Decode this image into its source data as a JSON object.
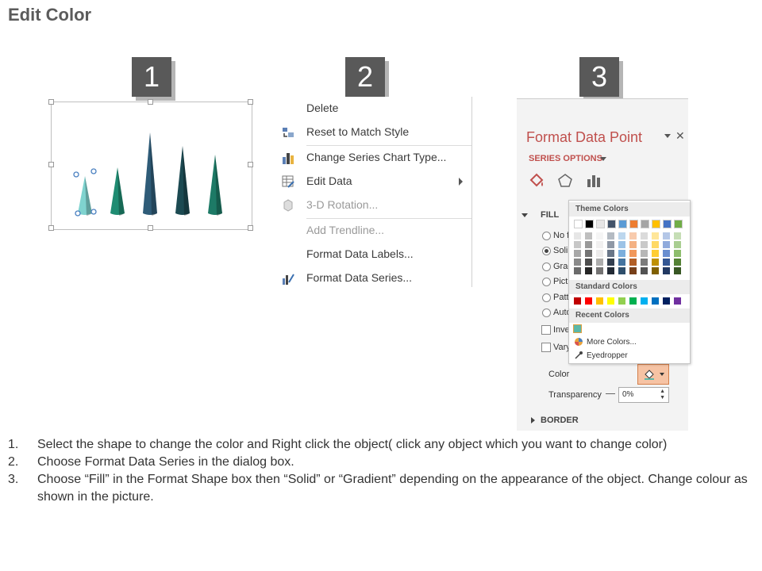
{
  "page": {
    "title": "Edit Color"
  },
  "badges": [
    "1",
    "2",
    "3"
  ],
  "context_menu": {
    "items": [
      {
        "label": "Delete",
        "icon": "none",
        "enabled": true
      },
      {
        "label": "Reset to Match Style",
        "icon": "reset-style-icon",
        "enabled": true
      },
      {
        "label": "Change Series Chart Type...",
        "icon": "bar-chart-icon",
        "enabled": true
      },
      {
        "label": "Edit Data",
        "icon": "edit-data-icon",
        "enabled": true,
        "submenu": true
      },
      {
        "label": "3-D Rotation...",
        "icon": "cube-icon",
        "enabled": false
      },
      {
        "label": "Add Trendline...",
        "icon": "none",
        "enabled": false
      },
      {
        "label": "Format Data Labels...",
        "icon": "none",
        "enabled": true
      },
      {
        "label": "Format Data Series...",
        "icon": "format-series-icon",
        "enabled": true
      }
    ]
  },
  "format_pane": {
    "title": "Format Data Point",
    "series_options": "SERIES OPTIONS",
    "fill_section": "FILL",
    "fill_options": [
      "No f",
      "Soli",
      "Grad",
      "Pict",
      "Patt",
      "Auto"
    ],
    "selected_option": 1,
    "checkboxes": [
      "Inve",
      "Vary"
    ],
    "color_label": "Color",
    "transparency_label": "Transparency",
    "transparency_value": "0%",
    "border_section": "BORDER"
  },
  "color_popup": {
    "theme_label": "Theme Colors",
    "standard_label": "Standard Colors",
    "recent_label": "Recent Colors",
    "more_colors": "More Colors...",
    "eyedropper": "Eyedropper",
    "theme_top_row": [
      "#ffffff",
      "#000000",
      "#e7e6e6",
      "#44546a",
      "#5b9bd5",
      "#ed7d31",
      "#a5a5a5",
      "#ffc000",
      "#4472c4",
      "#70ad47"
    ],
    "standard_colors": [
      "#c00000",
      "#ff0000",
      "#ffc000",
      "#ffff00",
      "#92d050",
      "#00b050",
      "#00b0f0",
      "#0070c0",
      "#002060",
      "#7030a0"
    ],
    "recent_colors": [
      "#5bb8a8"
    ]
  },
  "instructions": [
    {
      "num": "1.",
      "text": "Select the shape to change the color and Right click the object( click any object which you want to change color)"
    },
    {
      "num": "2.",
      "text": "Choose Format Data Series in the dialog box."
    },
    {
      "num": "3.",
      "text": "Choose “Fill” in the Format Shape box then “Solid” or “Gradient” depending on the appearance of the object. Change colour as shown in the picture."
    }
  ],
  "cone_chart": {
    "type": "bar",
    "values": [
      47,
      58,
      102,
      85,
      74
    ],
    "colors": [
      "#7fd3cf",
      "#1f8c72",
      "#2f5c78",
      "#1c4a52",
      "#1d7a66"
    ],
    "selected_index": 0
  }
}
